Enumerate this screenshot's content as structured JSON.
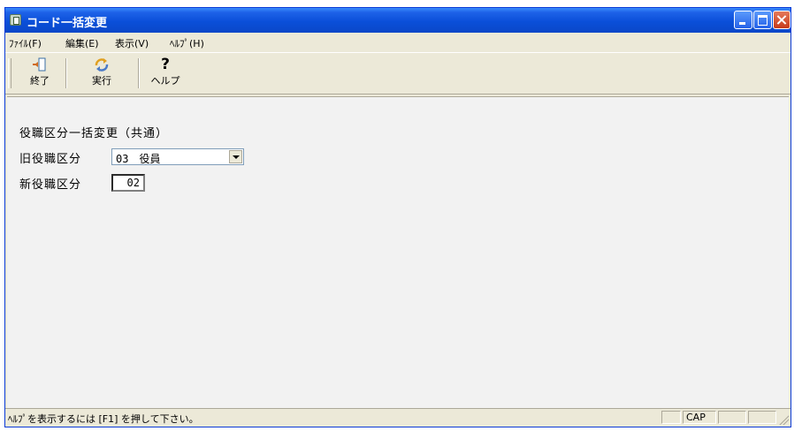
{
  "window": {
    "title": "コード一括変更"
  },
  "menu": {
    "items": [
      "ﾌｧｲﾙ(F)",
      "編集(E)",
      "表示(V)",
      "ﾍﾙﾌﾟ(H)"
    ]
  },
  "toolbar": {
    "exit_label": "終了",
    "run_label": "実行",
    "help_label": "ヘルプ"
  },
  "form": {
    "heading": "役職区分一括変更（共通）",
    "old_label": "旧役職区分",
    "old_value": "03　役員",
    "new_label": "新役職区分",
    "new_value": "02"
  },
  "statusbar": {
    "text": "ﾍﾙﾌﾟを表示するには [F1] を押して下さい。",
    "cap": "CAP"
  },
  "colors": {
    "titlebar": "#0a4fd9",
    "face": "#ece9d8",
    "content_bg": "#f2f2f2"
  }
}
